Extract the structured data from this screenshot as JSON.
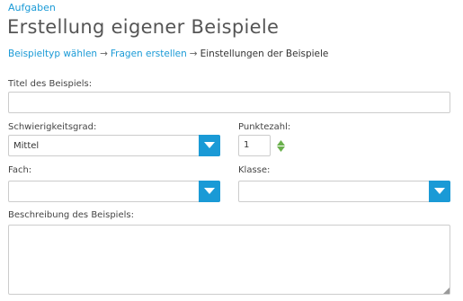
{
  "nav": {
    "top_link": "Aufgaben"
  },
  "page": {
    "title": "Erstellung eigener Beispiele"
  },
  "breadcrumb": {
    "step1": "Beispieltyp wählen",
    "step2": "Fragen erstellen",
    "step3": "Einstellungen der Beispiele",
    "separator": "→"
  },
  "form": {
    "title_label": "Titel des Beispiels:",
    "title_value": "",
    "difficulty_label": "Schwierigkeitsgrad:",
    "difficulty_value": "Mittel",
    "points_label": "Punktezahl:",
    "points_value": "1",
    "subject_label": "Fach:",
    "subject_value": "",
    "class_label": "Klasse:",
    "class_value": "",
    "description_label": "Beschreibung des Beispiels:",
    "description_value": ""
  },
  "colors": {
    "accent": "#1a9ad6",
    "stepper": "#6ab04c"
  },
  "icons": {
    "dropdown": "chevron-down-icon",
    "stepper": "up-down-arrows-icon",
    "resize": "resize-handle-icon"
  }
}
